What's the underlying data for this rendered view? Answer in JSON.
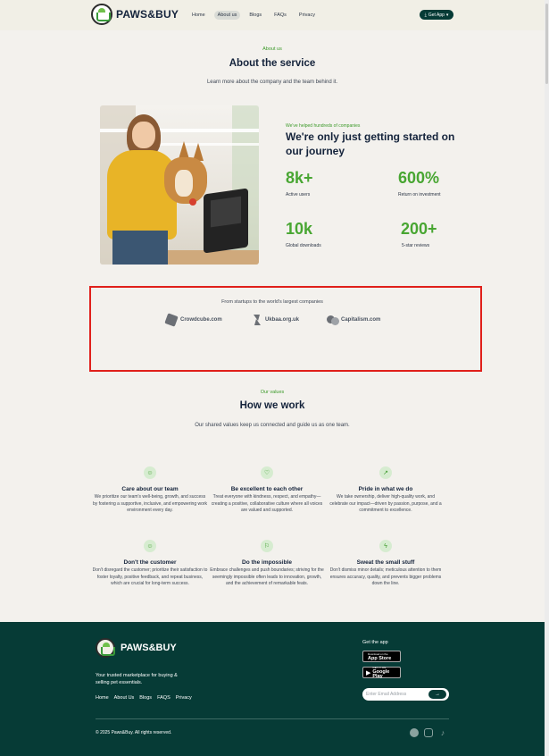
{
  "header": {
    "brand": "PAWS&BUY",
    "nav": [
      "Home",
      "About us",
      "Blogs",
      "FAQs",
      "Privacy"
    ],
    "active_nav": "About us",
    "get_app": "Get App"
  },
  "about": {
    "eyebrow": "About us",
    "title": "About the service",
    "subtitle": "Learn more about the company and the team behind it."
  },
  "stats": {
    "eyebrow": "We've helped hundreds of companies",
    "title": "We're only just getting started on our journey",
    "items": [
      {
        "value": "8k+",
        "label": "Active users"
      },
      {
        "value": "600%",
        "label": "Return on investment"
      },
      {
        "value": "10k",
        "label": "Global downloads"
      },
      {
        "value": "200+",
        "label": "5-star reviews"
      }
    ]
  },
  "logos": {
    "caption": "From startups to the world's largest companies",
    "items": [
      "Crowdcube.com",
      "Ukbaa.org.uk",
      "Capitalism.com"
    ]
  },
  "values": {
    "eyebrow": "Our values",
    "title": "How we work",
    "subtitle": "Our shared values keep us connected and guide us as one team.",
    "items": [
      {
        "icon": "users-icon",
        "title": "Care about our team",
        "desc": "We prioritize our team's well-being, growth, and success by fostering a supportive, inclusive, and empowering work environment every day."
      },
      {
        "icon": "heart-icon",
        "title": "Be excellent to each other",
        "desc": "Treat everyone with kindness, respect, and empathy—creating a positive, collaborative culture where all voices are valued and supported."
      },
      {
        "icon": "trend-up-icon",
        "title": "Pride in what we do",
        "desc": "We take ownership, deliver high-quality work, and celebrate our impact—driven by passion, purpose, and a commitment to excellence."
      },
      {
        "icon": "smile-icon",
        "title": "Don't the customer",
        "desc": "Don't disregard the customer; prioritize their satisfaction to foster loyalty, positive feedback, and repeat business, which are crucial for long-term success."
      },
      {
        "icon": "flag-icon",
        "title": "Do the impossible",
        "desc": "Embrace challenges and push boundaries; striving for the seemingly impossible often leads to innovation, growth, and the achievement of remarkable feats."
      },
      {
        "icon": "bolt-icon",
        "title": "Sweat the small stuff",
        "desc": "Don't dismiss minor details; meticulous attention to them ensures accuracy, quality, and prevents bigger problems down the line."
      }
    ]
  },
  "footer": {
    "brand": "PAWS&BUY",
    "tagline": "Your trusted marketplace for buying & selling pet essentials.",
    "links": [
      "Home",
      "About Us",
      "Blogs",
      "FAQS",
      "Privacy"
    ],
    "get_app_label": "Get the app",
    "app_store_small": "Download on the",
    "app_store": "App Store",
    "google_play_small": "GET IT ON",
    "google_play": "Google Play",
    "email_placeholder": "Enter Email Address",
    "copyright": "© 2025 Paws&Buy. All rights reserved."
  },
  "colors": {
    "accent_green": "#48a632",
    "footer_bg": "#063b36",
    "highlight_box": "#e0201b"
  }
}
